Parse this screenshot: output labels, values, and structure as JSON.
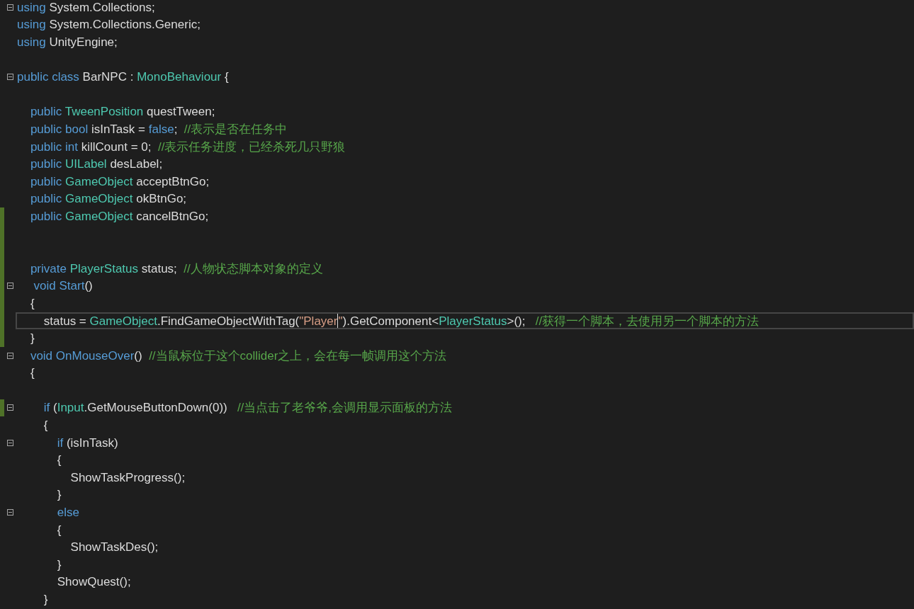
{
  "editor": {
    "lines": [
      {
        "fold": true,
        "changed": false,
        "current": false,
        "tokens": [
          {
            "kind": "keyword",
            "text": "using "
          },
          {
            "kind": "plain",
            "text": "System.Collections;"
          }
        ]
      },
      {
        "fold": false,
        "changed": false,
        "current": false,
        "tokens": [
          {
            "kind": "keyword",
            "text": "using "
          },
          {
            "kind": "plain",
            "text": "System.Collections.Generic;"
          }
        ]
      },
      {
        "fold": false,
        "changed": false,
        "current": false,
        "tokens": [
          {
            "kind": "keyword",
            "text": "using "
          },
          {
            "kind": "plain",
            "text": "UnityEngine;"
          }
        ]
      },
      {
        "fold": false,
        "changed": false,
        "current": false
      },
      {
        "fold": true,
        "changed": false,
        "current": false,
        "tokens": [
          {
            "kind": "keyword",
            "text": "public class "
          },
          {
            "kind": "plain",
            "text": "BarNPC : "
          },
          {
            "kind": "type",
            "text": "MonoBehaviour"
          },
          {
            "kind": "plain",
            "text": " {"
          }
        ]
      },
      {
        "fold": false,
        "changed": false,
        "current": false
      },
      {
        "fold": false,
        "changed": false,
        "current": false,
        "tokens": [
          {
            "kind": "keyword",
            "text": "    public "
          },
          {
            "kind": "type",
            "text": "TweenPosition"
          },
          {
            "kind": "plain",
            "text": " questTween;"
          }
        ]
      },
      {
        "fold": false,
        "changed": false,
        "current": false,
        "tokens": [
          {
            "kind": "keyword",
            "text": "    public bool"
          },
          {
            "kind": "plain",
            "text": " isInTask = "
          },
          {
            "kind": "keyword",
            "text": "false"
          },
          {
            "kind": "plain",
            "text": ";  "
          },
          {
            "kind": "comment",
            "text": "//表示是否在任务中"
          }
        ]
      },
      {
        "fold": false,
        "changed": false,
        "current": false,
        "tokens": [
          {
            "kind": "keyword",
            "text": "    public int"
          },
          {
            "kind": "plain",
            "text": " killCount = 0;  "
          },
          {
            "kind": "comment",
            "text": "//表示任务进度，已经杀死几只野狼"
          }
        ]
      },
      {
        "fold": false,
        "changed": false,
        "current": false,
        "tokens": [
          {
            "kind": "keyword",
            "text": "    public "
          },
          {
            "kind": "type",
            "text": "UILabel"
          },
          {
            "kind": "plain",
            "text": " desLabel;"
          }
        ]
      },
      {
        "fold": false,
        "changed": false,
        "current": false,
        "tokens": [
          {
            "kind": "keyword",
            "text": "    public "
          },
          {
            "kind": "type",
            "text": "GameObject"
          },
          {
            "kind": "plain",
            "text": " acceptBtnGo;"
          }
        ]
      },
      {
        "fold": false,
        "changed": false,
        "current": false,
        "tokens": [
          {
            "kind": "keyword",
            "text": "    public "
          },
          {
            "kind": "type",
            "text": "GameObject"
          },
          {
            "kind": "plain",
            "text": " okBtnGo;"
          }
        ]
      },
      {
        "fold": false,
        "changed": true,
        "current": false,
        "tokens": [
          {
            "kind": "keyword",
            "text": "    public "
          },
          {
            "kind": "type",
            "text": "GameObject"
          },
          {
            "kind": "plain",
            "text": " cancelBtnGo;"
          }
        ]
      },
      {
        "fold": false,
        "changed": true,
        "current": false
      },
      {
        "fold": false,
        "changed": true,
        "current": false
      },
      {
        "fold": false,
        "changed": true,
        "current": false,
        "tokens": [
          {
            "kind": "keyword",
            "text": "    private "
          },
          {
            "kind": "type",
            "text": "PlayerStatus"
          },
          {
            "kind": "plain",
            "text": " status;  "
          },
          {
            "kind": "comment",
            "text": "//人物状态脚本对象的定义"
          }
        ]
      },
      {
        "fold": true,
        "changed": true,
        "current": false,
        "tokens": [
          {
            "kind": "keyword",
            "text": "     void "
          },
          {
            "kind": "method",
            "text": "Start"
          },
          {
            "kind": "plain",
            "text": "()"
          }
        ]
      },
      {
        "fold": false,
        "changed": true,
        "current": false,
        "tokens": [
          {
            "kind": "plain",
            "text": "    {"
          }
        ]
      },
      {
        "fold": false,
        "changed": true,
        "current": true,
        "tokens": [
          {
            "kind": "plain",
            "text": "        status = "
          },
          {
            "kind": "type",
            "text": "GameObject"
          },
          {
            "kind": "plain",
            "text": ".FindGameObjectWithTag("
          },
          {
            "kind": "string",
            "text": "\"Player",
            "caret": true
          },
          {
            "kind": "string",
            "text": "\""
          },
          {
            "kind": "plain",
            "text": ").GetComponent<"
          },
          {
            "kind": "type",
            "text": "PlayerStatus"
          },
          {
            "kind": "plain",
            "text": ">();   "
          },
          {
            "kind": "comment",
            "text": "//获得一个脚本，去使用另一个脚本的方法"
          }
        ]
      },
      {
        "fold": false,
        "changed": true,
        "current": false,
        "tokens": [
          {
            "kind": "plain",
            "text": "    }"
          }
        ]
      },
      {
        "fold": true,
        "changed": false,
        "current": false,
        "tokens": [
          {
            "kind": "keyword",
            "text": "    void "
          },
          {
            "kind": "method",
            "text": "OnMouseOver"
          },
          {
            "kind": "plain",
            "text": "()  "
          },
          {
            "kind": "comment",
            "text": "//当鼠标位于这个collider之上，会在每一帧调用这个方法"
          }
        ]
      },
      {
        "fold": false,
        "changed": false,
        "current": false,
        "tokens": [
          {
            "kind": "plain",
            "text": "    {"
          }
        ]
      },
      {
        "fold": false,
        "changed": false,
        "current": false
      },
      {
        "fold": true,
        "changed": true,
        "current": false,
        "tokens": [
          {
            "kind": "keyword",
            "text": "        if"
          },
          {
            "kind": "plain",
            "text": " ("
          },
          {
            "kind": "type",
            "text": "Input"
          },
          {
            "kind": "plain",
            "text": ".GetMouseButtonDown(0))   "
          },
          {
            "kind": "comment",
            "text": "//当点击了老爷爷,会调用显示面板的方法"
          }
        ]
      },
      {
        "fold": false,
        "changed": false,
        "current": false,
        "tokens": [
          {
            "kind": "plain",
            "text": "        {"
          }
        ]
      },
      {
        "fold": true,
        "changed": false,
        "current": false,
        "tokens": [
          {
            "kind": "keyword",
            "text": "            if"
          },
          {
            "kind": "plain",
            "text": " (isInTask)"
          }
        ]
      },
      {
        "fold": false,
        "changed": false,
        "current": false,
        "tokens": [
          {
            "kind": "plain",
            "text": "            {"
          }
        ]
      },
      {
        "fold": false,
        "changed": false,
        "current": false,
        "tokens": [
          {
            "kind": "plain",
            "text": "                ShowTaskProgress();"
          }
        ]
      },
      {
        "fold": false,
        "changed": false,
        "current": false,
        "tokens": [
          {
            "kind": "plain",
            "text": "            }"
          }
        ]
      },
      {
        "fold": true,
        "changed": false,
        "current": false,
        "tokens": [
          {
            "kind": "keyword",
            "text": "            else"
          }
        ]
      },
      {
        "fold": false,
        "changed": false,
        "current": false,
        "tokens": [
          {
            "kind": "plain",
            "text": "            {"
          }
        ]
      },
      {
        "fold": false,
        "changed": false,
        "current": false,
        "tokens": [
          {
            "kind": "plain",
            "text": "                ShowTaskDes();"
          }
        ]
      },
      {
        "fold": false,
        "changed": false,
        "current": false,
        "tokens": [
          {
            "kind": "plain",
            "text": "            }"
          }
        ]
      },
      {
        "fold": false,
        "changed": false,
        "current": false,
        "tokens": [
          {
            "kind": "plain",
            "text": "            ShowQuest();"
          }
        ]
      },
      {
        "fold": false,
        "changed": false,
        "current": false,
        "tokens": [
          {
            "kind": "plain",
            "text": "        }"
          }
        ]
      }
    ]
  }
}
